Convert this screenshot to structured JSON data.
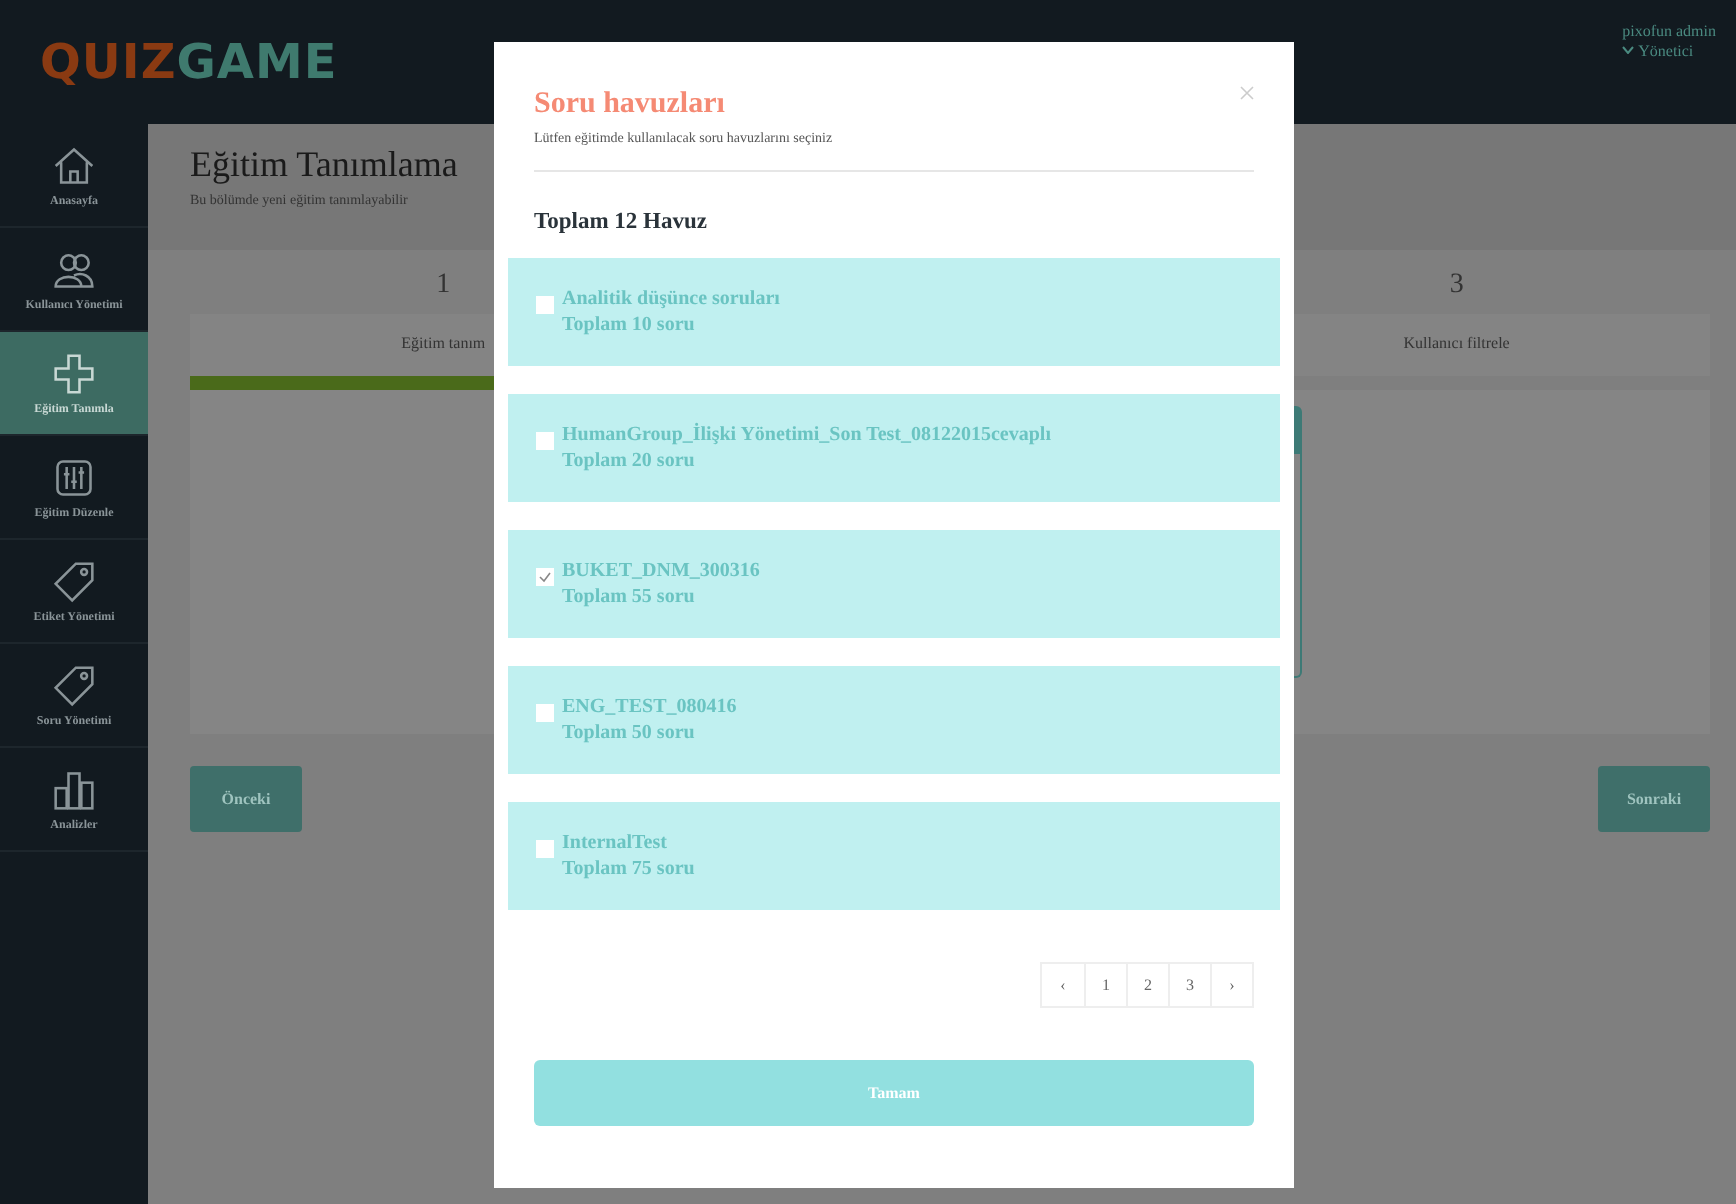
{
  "header": {
    "logo": {
      "part_1": "QUIZ",
      "part_2": "GAME"
    },
    "user": {
      "name": "pixofun admin",
      "role": "Yönetici"
    }
  },
  "sidebar": {
    "items": [
      {
        "label": "Anasayfa",
        "kind": "house",
        "selected": false
      },
      {
        "label": "Kullanıcı Yönetimi",
        "kind": "users",
        "selected": false
      },
      {
        "label": "Eğitim Tanımla",
        "kind": "plus",
        "selected": true
      },
      {
        "label": "Eğitim Düzenle",
        "kind": "sliders",
        "selected": false
      },
      {
        "label": "Etiket Yönetimi",
        "kind": "tag",
        "selected": false
      },
      {
        "label": "Soru Yönetimi",
        "kind": "tag",
        "selected": false
      },
      {
        "label": "Analizler",
        "kind": "chart",
        "selected": false
      }
    ]
  },
  "page": {
    "title": "Eğitim Tanımlama",
    "subtitle": "Bu bölümde yeni eğitim tanımlayabilir",
    "steps": [
      {
        "number": "1",
        "label": "Eğitim tanım"
      },
      {
        "number": "3",
        "label": "Kullanıcı filtrele"
      }
    ],
    "previous_button": "Önceki",
    "next_button": "Sonraki"
  },
  "modal": {
    "title": "Soru havuzları",
    "subtitle": "Lütfen eğitimde kullanılacak soru havuzlarını seçiniz",
    "total": "Toplam 12 Havuz",
    "pools": [
      {
        "name": "Analitik düşünce soruları",
        "count": "Toplam 10 soru",
        "checked": false
      },
      {
        "name": "HumanGroup_İlişki Yönetimi_Son Test_08122015cevaplı",
        "count": "Toplam 20 soru",
        "checked": false
      },
      {
        "name": "BUKET_DNM_300316",
        "count": "Toplam 55 soru",
        "checked": true
      },
      {
        "name": "ENG_TEST_080416",
        "count": "Toplam 50 soru",
        "checked": false
      },
      {
        "name": "InternalTest",
        "count": "Toplam 75 soru",
        "checked": false
      }
    ],
    "pagination": [
      "‹",
      "1",
      "2",
      "3",
      "›"
    ],
    "confirm_button": "Tamam"
  }
}
